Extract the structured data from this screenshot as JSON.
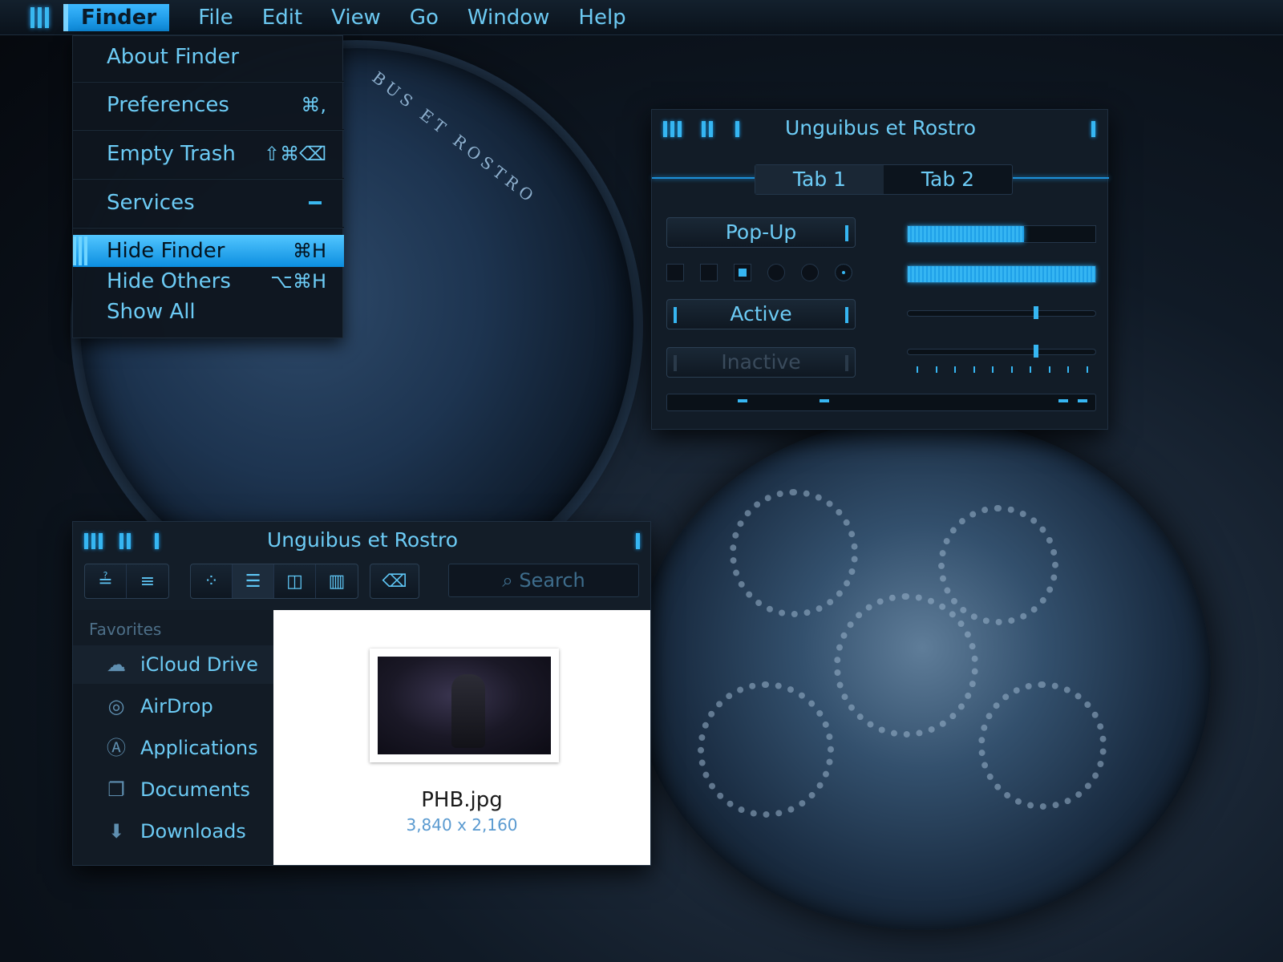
{
  "menubar": {
    "app": "Finder",
    "items": [
      "File",
      "Edit",
      "View",
      "Go",
      "Window",
      "Help"
    ]
  },
  "finder_menu": {
    "about": "About Finder",
    "preferences": {
      "label": "Preferences",
      "shortcut": "⌘,"
    },
    "empty_trash": {
      "label": "Empty Trash",
      "shortcut": "⇧⌘⌫"
    },
    "services": "Services",
    "hide": {
      "label": "Hide Finder",
      "shortcut": "⌘H"
    },
    "hide_others": {
      "label": "Hide Others",
      "shortcut": "⌥⌘H"
    },
    "show_all": "Show All"
  },
  "panel": {
    "title": "Unguibus et Rostro",
    "tabs": [
      "Tab 1",
      "Tab 2"
    ],
    "popup_label": "Pop-Up",
    "active_label": "Active",
    "inactive_label": "Inactive",
    "progress_1": 0.62,
    "progress_2": 1.0,
    "slider_1": 0.67,
    "slider_2": 0.67
  },
  "finder": {
    "title": "Unguibus et Rostro",
    "search_placeholder": "Search",
    "sidebar_heading": "Favorites",
    "sidebar_items": [
      {
        "label": "iCloud Drive",
        "icon": "cloud-icon"
      },
      {
        "label": "AirDrop",
        "icon": "airdrop-icon"
      },
      {
        "label": "Applications",
        "icon": "applications-icon"
      },
      {
        "label": "Documents",
        "icon": "documents-icon"
      },
      {
        "label": "Downloads",
        "icon": "downloads-icon"
      }
    ],
    "file": {
      "name": "PHB.jpg",
      "dimensions": "3,840 x 2,160"
    }
  },
  "wallpaper": {
    "coin_text": "BUS ET ROSTRO"
  },
  "colors": {
    "accent": "#36b6f2",
    "background": "#0a121b"
  }
}
